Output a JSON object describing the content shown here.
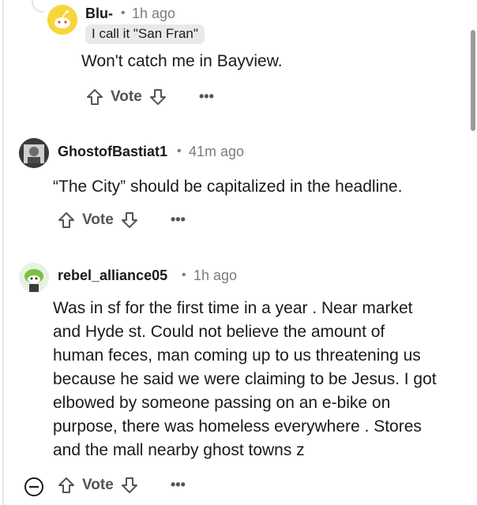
{
  "comments": [
    {
      "username": "Blu-",
      "time": "1h ago",
      "flair": "I call it \"San Fran\"",
      "body": "Won't catch me in Bayview.",
      "vote_label": "Vote",
      "avatar_icon": "snoo-yellow-avatar"
    },
    {
      "username": "GhostofBastiat1",
      "time": "41m ago",
      "body": "“The City” should be capitalized in the headline.",
      "vote_label": "Vote",
      "avatar_icon": "portrait-avatar"
    },
    {
      "username": "rebel_alliance05",
      "time": "1h ago",
      "body_lines": [
        "Was in sf for the first time in a year . Near market",
        "and Hyde st. Could not believe the amount of",
        "human feces, man coming up to us threatening us",
        "because he said we were claiming to be Jesus. I got",
        "elbowed by someone passing on an e-bike on",
        "purpose, there was homeless everywhere . Stores",
        "and the mall nearby ghost towns z"
      ],
      "vote_label": "Vote",
      "avatar_icon": "snoo-green-avatar"
    }
  ],
  "separator": "•",
  "more_label": "•••",
  "colors": {
    "text": "#1a1a1b",
    "meta": "#7c7c7c",
    "action": "#545454",
    "thread_line": "#e3e5e8",
    "flair_bg": "#e9e9ea"
  }
}
